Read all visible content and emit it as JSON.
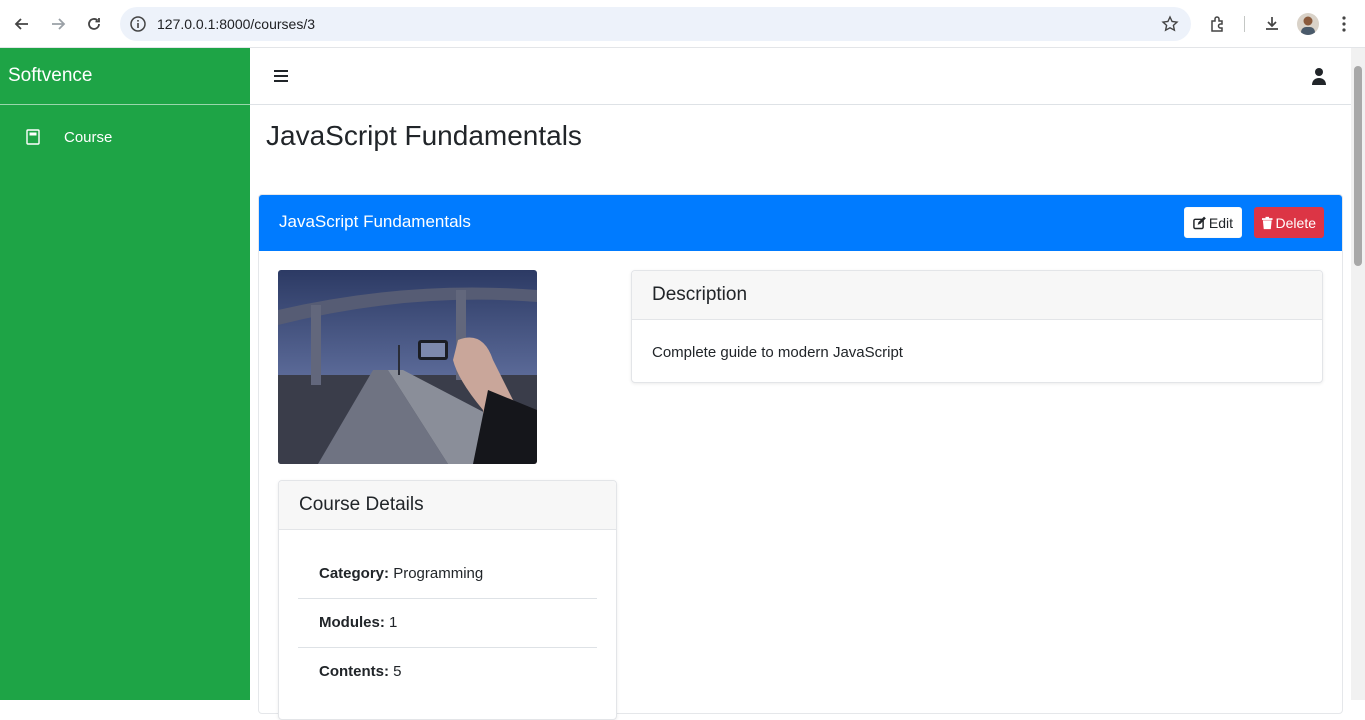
{
  "browser": {
    "url": "127.0.0.1:8000/courses/3"
  },
  "sidebar": {
    "brand": "Softvence",
    "items": [
      {
        "label": "Course",
        "icon": "book-icon"
      }
    ],
    "color": "#1ea446"
  },
  "page": {
    "title": "JavaScript Fundamentals"
  },
  "course_card": {
    "header_title": "JavaScript Fundamentals",
    "header_color": "#007bff",
    "edit_label": "Edit",
    "delete_label": "Delete",
    "delete_color": "#dc3545"
  },
  "description": {
    "heading": "Description",
    "text": "Complete guide to modern JavaScript"
  },
  "details": {
    "heading": "Course Details",
    "rows": [
      {
        "key": "Category:",
        "value": "Programming"
      },
      {
        "key": "Modules:",
        "value": "1"
      },
      {
        "key": "Contents:",
        "value": "5"
      }
    ]
  }
}
